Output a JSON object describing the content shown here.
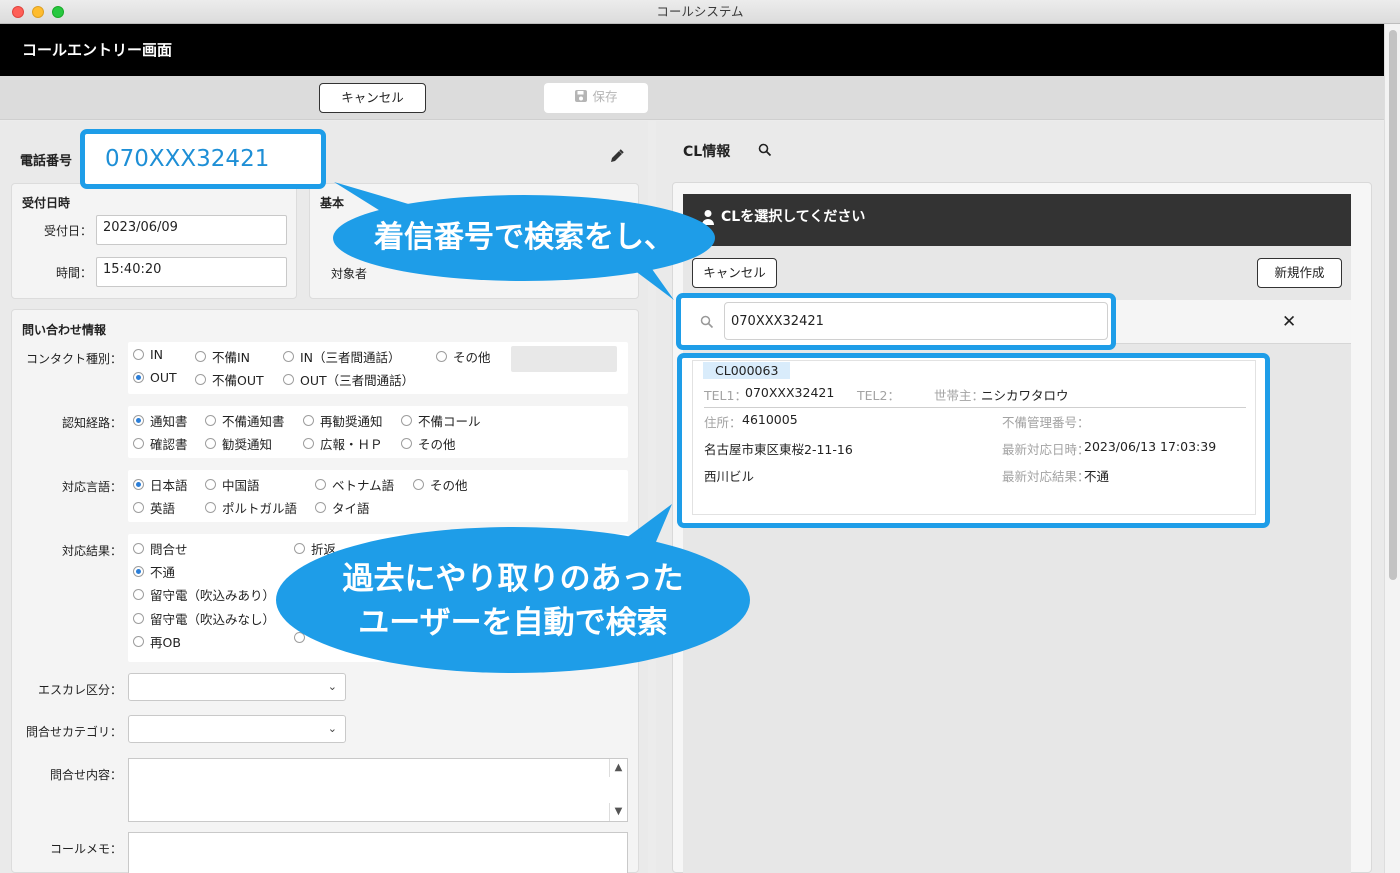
{
  "window": {
    "title": "コールシステム"
  },
  "header": {
    "title": "コールエントリー画面"
  },
  "toolbar": {
    "cancel_label": "キャンセル",
    "save_label": "保存"
  },
  "phone": {
    "label": "電話番号",
    "value": "070XXX32421"
  },
  "reception": {
    "heading": "受付日時",
    "date_label": "受付日：",
    "date_value": "2023/06/09",
    "time_label": "時間：",
    "time_value": "15:40:20"
  },
  "basic": {
    "heading": "基本",
    "target_label": "対象者"
  },
  "inquiry": {
    "heading": "問い合わせ情報",
    "contact_label": "コンタクト種別：",
    "contact_options": [
      "IN",
      "不備IN",
      "IN（三者間通話）",
      "その他",
      "OUT",
      "不備OUT",
      "OUT（三者間通話）"
    ],
    "contact_selected": "OUT",
    "route_label": "認知経路：",
    "route_options": [
      "通知書",
      "不備通知書",
      "再勧奨通知",
      "不備コール",
      "確認書",
      "勧奨通知",
      "広報・ＨＰ",
      "その他"
    ],
    "route_selected": "通知書",
    "lang_label": "対応言語：",
    "lang_options": [
      "日本語",
      "中国語",
      "ベトナム語",
      "その他",
      "英語",
      "ポルトガル語",
      "タイ語"
    ],
    "lang_selected": "日本語",
    "result_label": "対応結果：",
    "result_options": [
      "問合せ",
      "不通",
      "留守電（吹込みあり）",
      "留守電（吹込みなし）",
      "再OB",
      "折返"
    ],
    "result_selected": "不通",
    "escalation_label": "エスカレ区分：",
    "category_label": "問合せカテゴリ：",
    "content_label": "問合せ内容：",
    "memo_label": "コールメモ："
  },
  "cl": {
    "title": "CL情報",
    "modal_title": "CLを選択してください",
    "cancel_label": "キャンセル",
    "new_label": "新規作成",
    "search_value": "070XXX32421",
    "result": {
      "code": "CL000063",
      "tel1_label": "TEL1：",
      "tel1": "070XXX32421",
      "tel2_label": "TEL2：",
      "head_label": "世帯主：",
      "head": "ニシカワタロウ",
      "addr_label": "住所：",
      "zip": "4610005",
      "addr1": "名古屋市東区東桜2-11-16",
      "addr2": "西川ビル",
      "defect_label": "不備管理番号：",
      "last_date_label": "最新対応日時：",
      "last_date": "2023/06/13 17:03:39",
      "last_result_label": "最新対応結果：",
      "last_result": "不通"
    }
  },
  "callouts": {
    "search": "着信番号で検索をし、",
    "auto_line1": "過去にやり取りのあった",
    "auto_line2": "ユーザーを自動で検索"
  },
  "colors": {
    "accent": "#1e9de8",
    "header": "#000000",
    "radio_on": "#2b7ed8"
  }
}
